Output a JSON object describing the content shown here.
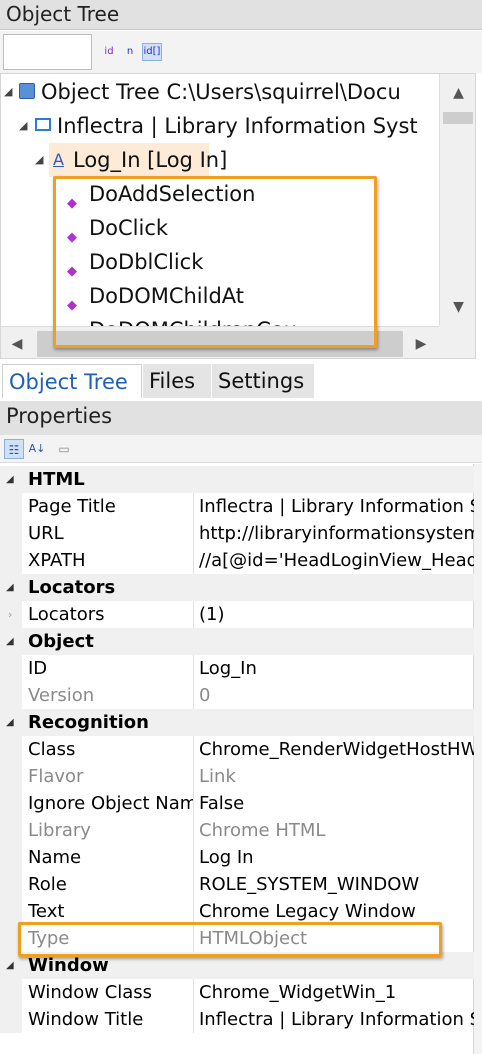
{
  "window": {
    "title": "Object Tree"
  },
  "toolbar": {
    "search_value": "",
    "btn_id": "id",
    "btn_n": "n",
    "btn_idb": "id[]"
  },
  "tree": {
    "root": "Object Tree C:\\Users\\squirrel\\Docu",
    "app": "Inflectra | Library Information Syst",
    "login": "Log_In [Log In]",
    "methods": [
      "DoAddSelection",
      "DoClick",
      "DoDblClick",
      "DoDOMChildAt",
      "DoDOMChildrenCount"
    ]
  },
  "tabs": [
    "Object Tree",
    "Files",
    "Settings"
  ],
  "active_tab": "Object Tree",
  "properties": {
    "title": "Properties",
    "categories": {
      "html": "HTML",
      "locators": "Locators",
      "object": "Object",
      "recognition": "Recognition",
      "window": "Window"
    },
    "html": [
      {
        "name": "Page Title",
        "value": "Inflectra | Library Information Syst"
      },
      {
        "name": "URL",
        "value": "http://libraryinformationsystem.org"
      },
      {
        "name": "XPATH",
        "value": "//a[@id='HeadLoginView_HeadLoginStatus']"
      }
    ],
    "locators": [
      {
        "name": "Locators",
        "value": "(1)"
      }
    ],
    "object": [
      {
        "name": "ID",
        "value": "Log_In"
      },
      {
        "name": "Version",
        "value": "0"
      }
    ],
    "recognition": [
      {
        "name": "Class",
        "value": "Chrome_RenderWidgetHostHWND"
      },
      {
        "name": "Flavor",
        "value": "Link"
      },
      {
        "name": "Ignore Object Name",
        "value": "False"
      },
      {
        "name": "Library",
        "value": "Chrome HTML"
      },
      {
        "name": "Name",
        "value": "Log In"
      },
      {
        "name": "Role",
        "value": "ROLE_SYSTEM_WINDOW"
      },
      {
        "name": "Text",
        "value": "Chrome Legacy Window"
      },
      {
        "name": "Type",
        "value": "HTMLObject"
      }
    ],
    "window": [
      {
        "name": "Window Class",
        "value": "Chrome_WidgetWin_1"
      },
      {
        "name": "Window Title",
        "value": "Inflectra | Library Information Syst"
      }
    ]
  },
  "colors": {
    "highlight": "#f0a020",
    "active_tab_text": "#1f5fb4",
    "method_icon": "#b030d0"
  }
}
